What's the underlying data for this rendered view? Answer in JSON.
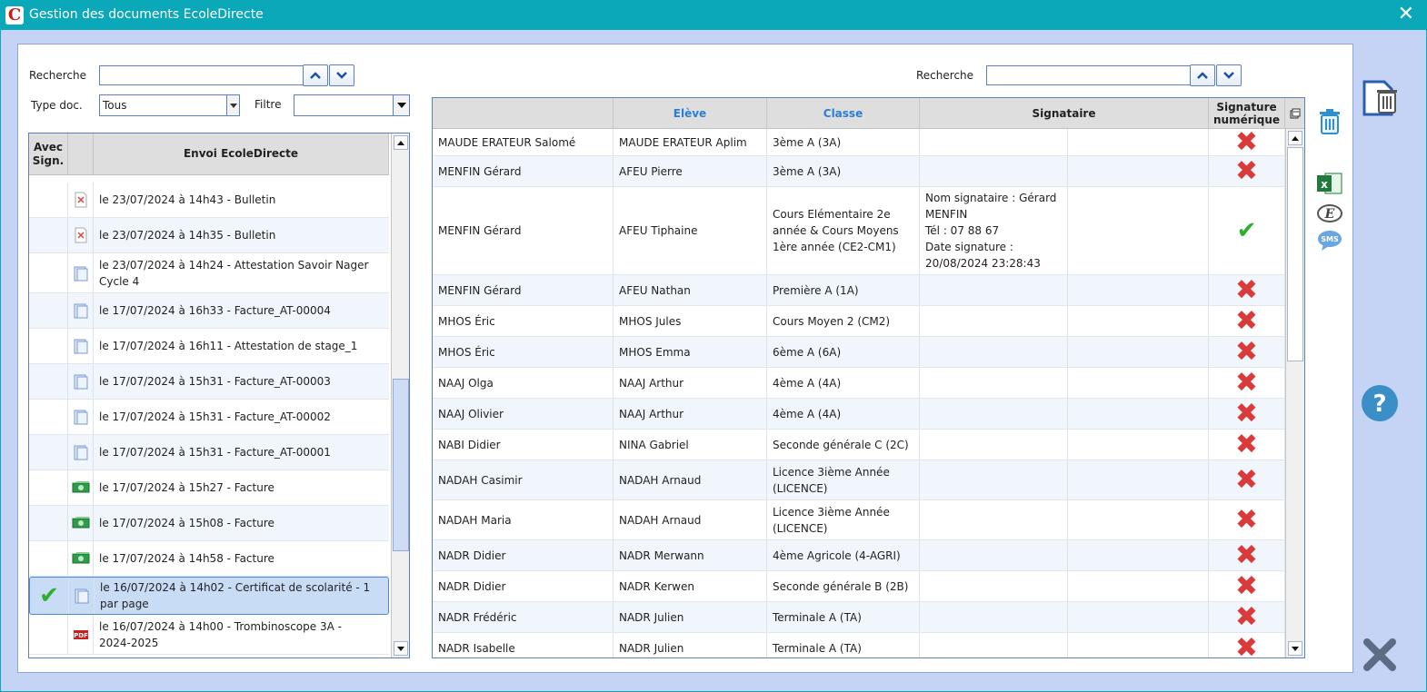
{
  "window": {
    "title": "Gestion des documents EcoleDirecte",
    "logo_letter": "C"
  },
  "left": {
    "search_label": "Recherche",
    "type_label": "Type doc.",
    "type_value": "Tous",
    "filter_label": "Filtre",
    "filter_value": "",
    "col_sign": "Avec Sign.",
    "col_envoi": "Envoi EcoleDirecte",
    "rows": [
      {
        "text": "le 23/07/2024 à 14h43 - Bulletin",
        "icon": "bulletin-icon",
        "signed": false
      },
      {
        "text": "le 23/07/2024 à 14h35 - Bulletin",
        "icon": "bulletin-icon",
        "signed": false
      },
      {
        "text": "le 23/07/2024 à 14h24 - Attestation Savoir Nager Cycle 4",
        "icon": "document-icon",
        "signed": false
      },
      {
        "text": "le 17/07/2024 à 16h33 - Facture_AT-00004",
        "icon": "document-icon",
        "signed": false
      },
      {
        "text": "le 17/07/2024 à 16h11 - Attestation de stage_1",
        "icon": "document-icon",
        "signed": false
      },
      {
        "text": "le 17/07/2024 à 15h31 - Facture_AT-00003",
        "icon": "document-icon",
        "signed": false
      },
      {
        "text": "le 17/07/2024 à 15h31 - Facture_AT-00002",
        "icon": "document-icon",
        "signed": false
      },
      {
        "text": "le 17/07/2024 à 15h31 - Facture_AT-00001",
        "icon": "document-icon",
        "signed": false
      },
      {
        "text": "le 17/07/2024 à 15h27 - Facture",
        "icon": "banknote-icon",
        "signed": false
      },
      {
        "text": "le 17/07/2024 à 15h08 - Facture",
        "icon": "banknote-icon",
        "signed": false
      },
      {
        "text": "le 17/07/2024 à 14h58 - Facture",
        "icon": "banknote-icon",
        "signed": false
      },
      {
        "text": "le 16/07/2024 à 14h02 - Certificat de scolarité - 1 par page",
        "icon": "document-icon",
        "signed": true
      },
      {
        "text": "le 16/07/2024 à 14h00 - Trombinoscope 3A - 2024-2025",
        "icon": "pdf-icon",
        "signed": false
      }
    ]
  },
  "right": {
    "search_label": "Recherche",
    "col_name": "",
    "col_eleve": "Elève",
    "col_classe": "Classe",
    "col_signataire": "Signataire",
    "col_signature": "Signature numérique",
    "rows": [
      {
        "name": "MAUDE ERATEUR Salomé",
        "eleve": "MAUDE ERATEUR Aplim",
        "classe": "3ème A (3A)",
        "signataire": "",
        "signed": false
      },
      {
        "name": "MENFIN Gérard",
        "eleve": "AFEU Pierre",
        "classe": "3ème A (3A)",
        "signataire": "",
        "signed": false
      },
      {
        "name": "MENFIN Gérard",
        "eleve": "AFEU Tiphaine",
        "classe": "Cours Elémentaire 2e année & Cours Moyens 1ère année (CE2-CM1)",
        "signataire": "Nom signataire : Gérard MENFIN\nTél : 07 88 67\nDate signature : 20/08/2024 23:28:43",
        "signed": true
      },
      {
        "name": "MENFIN Gérard",
        "eleve": "AFEU Nathan",
        "classe": "Première A (1A)",
        "signataire": "",
        "signed": false
      },
      {
        "name": "MHOS Éric",
        "eleve": "MHOS Jules",
        "classe": "Cours Moyen 2 (CM2)",
        "signataire": "",
        "signed": false
      },
      {
        "name": "MHOS Éric",
        "eleve": "MHOS Emma",
        "classe": "6ème A (6A)",
        "signataire": "",
        "signed": false
      },
      {
        "name": "NAAJ Olga",
        "eleve": "NAAJ Arthur",
        "classe": "4ème A (4A)",
        "signataire": "",
        "signed": false
      },
      {
        "name": "NAAJ Olivier",
        "eleve": "NAAJ Arthur",
        "classe": "4ème A (4A)",
        "signataire": "",
        "signed": false
      },
      {
        "name": "NABI Didier",
        "eleve": "NINA Gabriel",
        "classe": "Seconde générale C (2C)",
        "signataire": "",
        "signed": false
      },
      {
        "name": "NADAH Casimir",
        "eleve": "NADAH Arnaud",
        "classe": "Licence 3ième Année (LICENCE)",
        "signataire": "",
        "signed": false
      },
      {
        "name": "NADAH Maria",
        "eleve": "NADAH Arnaud",
        "classe": "Licence 3ième Année (LICENCE)",
        "signataire": "",
        "signed": false
      },
      {
        "name": "NADR Didier",
        "eleve": "NADR Merwann",
        "classe": "4ème Agricole (4-AGRI)",
        "signataire": "",
        "signed": false
      },
      {
        "name": "NADR Didier",
        "eleve": "NADR Kerwen",
        "classe": "Seconde générale B (2B)",
        "signataire": "",
        "signed": false
      },
      {
        "name": "NADR Frédéric",
        "eleve": "NADR Julien",
        "classe": "Terminale A (TA)",
        "signataire": "",
        "signed": false
      },
      {
        "name": "NADR Isabelle",
        "eleve": "NADR Julien",
        "classe": "Terminale A (TA)",
        "signataire": "",
        "signed": false
      }
    ]
  },
  "colors": {
    "titlebar": "#0aa8b9",
    "accent_blue": "#2a7fd4",
    "reject_red": "#d93a3a",
    "ok_green": "#2fae2f"
  }
}
